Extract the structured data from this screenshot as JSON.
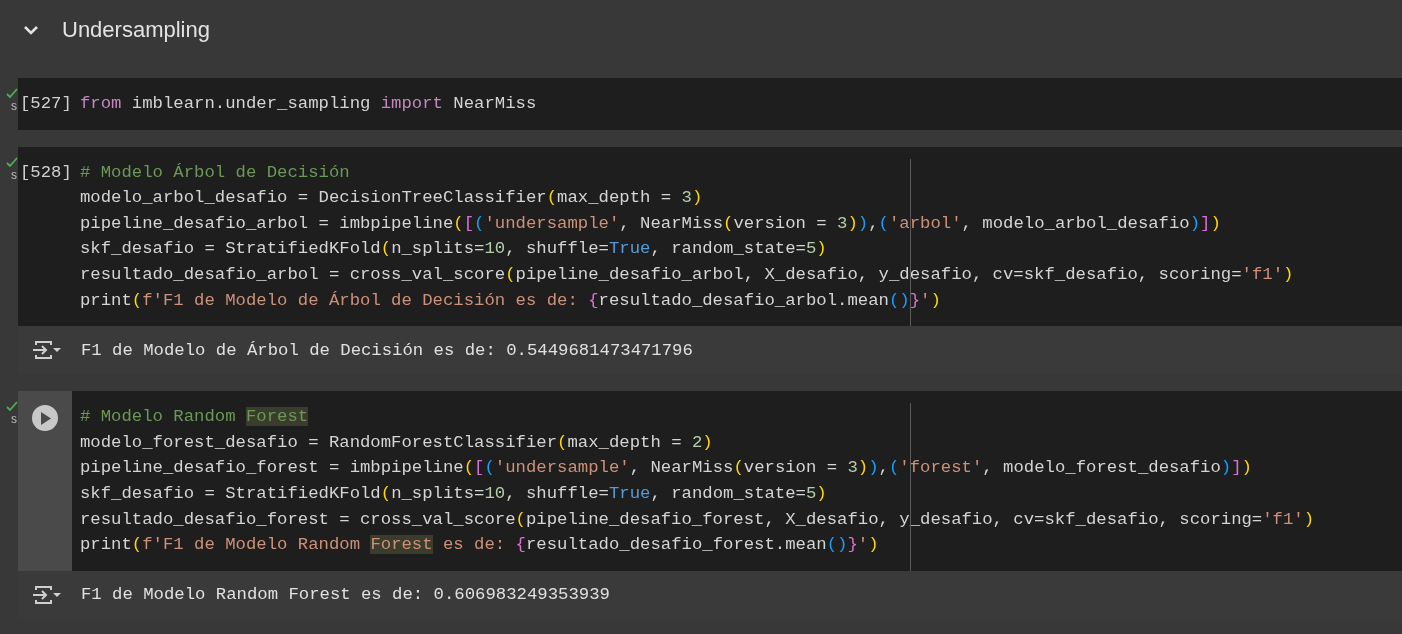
{
  "section": {
    "title": "Undersampling",
    "expanded": true
  },
  "cells": [
    {
      "executed": true,
      "exec_time": "s",
      "hovered": false,
      "prompt": "[527]",
      "lines": [
        [
          {
            "kind": "keyword",
            "text": "from"
          },
          {
            "kind": "plain",
            "text": " imblearn.under_sampling "
          },
          {
            "kind": "keyword",
            "text": "import"
          },
          {
            "kind": "plain",
            "text": " NearMiss"
          }
        ]
      ]
    },
    {
      "executed": true,
      "exec_time": "s",
      "hovered": false,
      "prompt": "[528]",
      "ruler": true,
      "lines": [
        [
          {
            "kind": "comment",
            "text": "# Modelo Árbol de Decisión"
          }
        ],
        [
          {
            "kind": "plain",
            "text": "modelo_arbol_desafio = DecisionTreeClassifier"
          },
          {
            "kind": "bracket_gold",
            "text": "("
          },
          {
            "kind": "plain",
            "text": "max_depth = "
          },
          {
            "kind": "number",
            "text": "3"
          },
          {
            "kind": "bracket_gold",
            "text": ")"
          }
        ],
        [
          {
            "kind": "plain",
            "text": "pipeline_desafio_arbol = imbpipeline"
          },
          {
            "kind": "bracket_gold",
            "text": "("
          },
          {
            "kind": "bracket_pink",
            "text": "["
          },
          {
            "kind": "bracket_blue",
            "text": "("
          },
          {
            "kind": "string",
            "text": "'undersample'"
          },
          {
            "kind": "plain",
            "text": ", NearMiss"
          },
          {
            "kind": "bracket_gold",
            "text": "("
          },
          {
            "kind": "plain",
            "text": "version = "
          },
          {
            "kind": "number",
            "text": "3"
          },
          {
            "kind": "bracket_gold",
            "text": ")"
          },
          {
            "kind": "bracket_blue",
            "text": ")"
          },
          {
            "kind": "plain",
            "text": ","
          },
          {
            "kind": "bracket_blue",
            "text": "("
          },
          {
            "kind": "string",
            "text": "'arbol'"
          },
          {
            "kind": "plain",
            "text": ", modelo_arbol_desafio"
          },
          {
            "kind": "bracket_blue",
            "text": ")"
          },
          {
            "kind": "bracket_pink",
            "text": "]"
          },
          {
            "kind": "bracket_gold",
            "text": ")"
          }
        ],
        [
          {
            "kind": "plain",
            "text": "skf_desafio = StratifiedKFold"
          },
          {
            "kind": "bracket_gold",
            "text": "("
          },
          {
            "kind": "plain",
            "text": "n_splits="
          },
          {
            "kind": "number",
            "text": "10"
          },
          {
            "kind": "plain",
            "text": ", shuffle="
          },
          {
            "kind": "constant",
            "text": "True"
          },
          {
            "kind": "plain",
            "text": ", random_state="
          },
          {
            "kind": "number",
            "text": "5"
          },
          {
            "kind": "bracket_gold",
            "text": ")"
          }
        ],
        [
          {
            "kind": "plain",
            "text": "resultado_desafio_arbol = cross_val_score"
          },
          {
            "kind": "bracket_gold",
            "text": "("
          },
          {
            "kind": "plain",
            "text": "pipeline_desafio_arbol, X_desafio, y_desafio, cv=skf_desafio, scoring="
          },
          {
            "kind": "string",
            "text": "'f1'"
          },
          {
            "kind": "bracket_gold",
            "text": ")"
          }
        ],
        [
          {
            "kind": "plain",
            "text": "print"
          },
          {
            "kind": "bracket_gold",
            "text": "("
          },
          {
            "kind": "string",
            "text": "f'F1 de Modelo de Árbol de Decisión es de: "
          },
          {
            "kind": "bracket_pink",
            "text": "{"
          },
          {
            "kind": "plain",
            "text": "resultado_desafio_arbol.mean"
          },
          {
            "kind": "bracket_blue",
            "text": "()"
          },
          {
            "kind": "bracket_pink",
            "text": "}"
          },
          {
            "kind": "string",
            "text": "'"
          },
          {
            "kind": "bracket_gold",
            "text": ")"
          }
        ]
      ],
      "output": "F1 de Modelo de Árbol de Decisión es de: 0.5449681473471796"
    },
    {
      "executed": true,
      "exec_time": "s",
      "hovered": true,
      "ruler": true,
      "lines": [
        [
          {
            "kind": "comment",
            "text": "# Modelo Random "
          },
          {
            "kind": "comment",
            "text": "Forest",
            "highlight": true
          }
        ],
        [
          {
            "kind": "plain",
            "text": "modelo_forest_desafio = RandomForestClassifier"
          },
          {
            "kind": "bracket_gold",
            "text": "("
          },
          {
            "kind": "plain",
            "text": "max_depth = "
          },
          {
            "kind": "number",
            "text": "2"
          },
          {
            "kind": "bracket_gold",
            "text": ")"
          }
        ],
        [
          {
            "kind": "plain",
            "text": "pipeline_desafio_forest = imbpipeline"
          },
          {
            "kind": "bracket_gold",
            "text": "("
          },
          {
            "kind": "bracket_pink",
            "text": "["
          },
          {
            "kind": "bracket_blue",
            "text": "("
          },
          {
            "kind": "string",
            "text": "'undersample'"
          },
          {
            "kind": "plain",
            "text": ", NearMiss"
          },
          {
            "kind": "bracket_gold",
            "text": "("
          },
          {
            "kind": "plain",
            "text": "version = "
          },
          {
            "kind": "number",
            "text": "3"
          },
          {
            "kind": "bracket_gold",
            "text": ")"
          },
          {
            "kind": "bracket_blue",
            "text": ")"
          },
          {
            "kind": "plain",
            "text": ","
          },
          {
            "kind": "bracket_blue",
            "text": "("
          },
          {
            "kind": "string",
            "text": "'forest'"
          },
          {
            "kind": "plain",
            "text": ", modelo_forest_desafio"
          },
          {
            "kind": "bracket_blue",
            "text": ")"
          },
          {
            "kind": "bracket_pink",
            "text": "]"
          },
          {
            "kind": "bracket_gold",
            "text": ")"
          }
        ],
        [
          {
            "kind": "plain",
            "text": "skf_desafio = StratifiedKFold"
          },
          {
            "kind": "bracket_gold",
            "text": "("
          },
          {
            "kind": "plain",
            "text": "n_splits="
          },
          {
            "kind": "number",
            "text": "10"
          },
          {
            "kind": "plain",
            "text": ", shuffle="
          },
          {
            "kind": "constant",
            "text": "True"
          },
          {
            "kind": "plain",
            "text": ", random_state="
          },
          {
            "kind": "number",
            "text": "5"
          },
          {
            "kind": "bracket_gold",
            "text": ")"
          }
        ],
        [
          {
            "kind": "plain",
            "text": "resultado_desafio_forest = cross_val_score"
          },
          {
            "kind": "bracket_gold",
            "text": "("
          },
          {
            "kind": "plain",
            "text": "pipeline_desafio_forest, X_desafio, y_desafio, cv=skf_desafio, scoring="
          },
          {
            "kind": "string",
            "text": "'f1'"
          },
          {
            "kind": "bracket_gold",
            "text": ")"
          }
        ],
        [
          {
            "kind": "plain",
            "text": "print"
          },
          {
            "kind": "bracket_gold",
            "text": "("
          },
          {
            "kind": "string",
            "text": "f'F1 de Modelo Random "
          },
          {
            "kind": "string",
            "text": "Forest",
            "highlight": true
          },
          {
            "kind": "string",
            "text": " es de: "
          },
          {
            "kind": "bracket_pink",
            "text": "{"
          },
          {
            "kind": "plain",
            "text": "resultado_desafio_forest.mean"
          },
          {
            "kind": "bracket_blue",
            "text": "()"
          },
          {
            "kind": "bracket_pink",
            "text": "}"
          },
          {
            "kind": "string",
            "text": "'"
          },
          {
            "kind": "bracket_gold",
            "text": ")"
          }
        ]
      ],
      "output": "F1 de Modelo Random Forest es de: 0.606983249353939"
    }
  ]
}
